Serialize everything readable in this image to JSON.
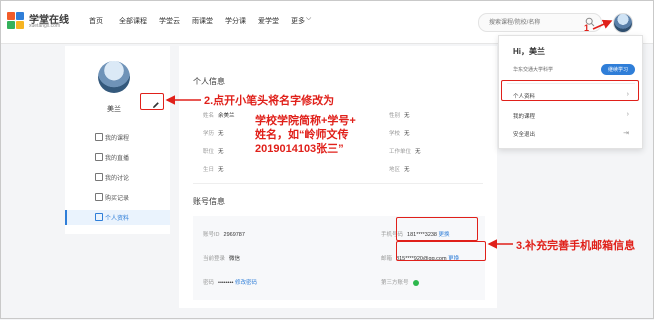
{
  "logo": {
    "name": "学堂在线",
    "domain": "xuetangx.com"
  },
  "nav": {
    "items": [
      "首页",
      "全部课程",
      "学堂云",
      "雨课堂",
      "学分课",
      "爱学堂",
      "更多"
    ]
  },
  "search": {
    "placeholder": "搜索课程/院校/名称"
  },
  "profile": {
    "username": "美兰"
  },
  "sidebar": {
    "items": [
      {
        "label": "我的课程",
        "icon": "book-icon"
      },
      {
        "label": "我的直播",
        "icon": "video-icon"
      },
      {
        "label": "我的讨论",
        "icon": "chat-icon"
      },
      {
        "label": "购买记录",
        "icon": "receipt-icon"
      },
      {
        "label": "个人资料",
        "icon": "id-card-icon",
        "active": true
      }
    ]
  },
  "personal_info": {
    "title": "个人信息",
    "fields": [
      {
        "label": "姓名",
        "value": "余美兰"
      },
      {
        "label": "性别",
        "value": "无"
      },
      {
        "label": "学历",
        "value": "无"
      },
      {
        "label": "学校",
        "value": "无"
      },
      {
        "label": "职位",
        "value": "无"
      },
      {
        "label": "工作单位",
        "value": "无"
      },
      {
        "label": "生日",
        "value": "无"
      },
      {
        "label": "地区",
        "value": "无"
      }
    ]
  },
  "account_info": {
    "title": "账号信息",
    "fields": [
      {
        "label": "账号ID",
        "value": "2969787"
      },
      {
        "label": "手机号码",
        "value": "181****3238",
        "action": "更换"
      },
      {
        "label": "当前登录",
        "value": "微信"
      },
      {
        "label": "邮箱",
        "value": "815****920@qq.com",
        "action": "更换"
      },
      {
        "label": "密码",
        "value": "••••••••",
        "action": "修改密码"
      },
      {
        "label": "第三方账号",
        "value": ""
      }
    ]
  },
  "dropdown": {
    "greeting": "Hi，美兰",
    "school": "华东交通大学科学",
    "cta": "继续学习",
    "items": [
      {
        "label": "个人资料"
      },
      {
        "label": "我的课程"
      },
      {
        "label": "安全退出"
      }
    ]
  },
  "annotations": {
    "step1": "1",
    "step2": "2.点开小笔头将名字修改为",
    "step2_text_line1": "学校学院简称+学号+",
    "step2_text_line2": "姓名，如“岭师文传",
    "step2_text_line3": "2019014103张三”",
    "step3": "3.补充完善手机邮箱信息",
    "color": "#e0201a"
  },
  "colors": {
    "accent": "#2f7ed8",
    "annotation": "#e0201a"
  }
}
